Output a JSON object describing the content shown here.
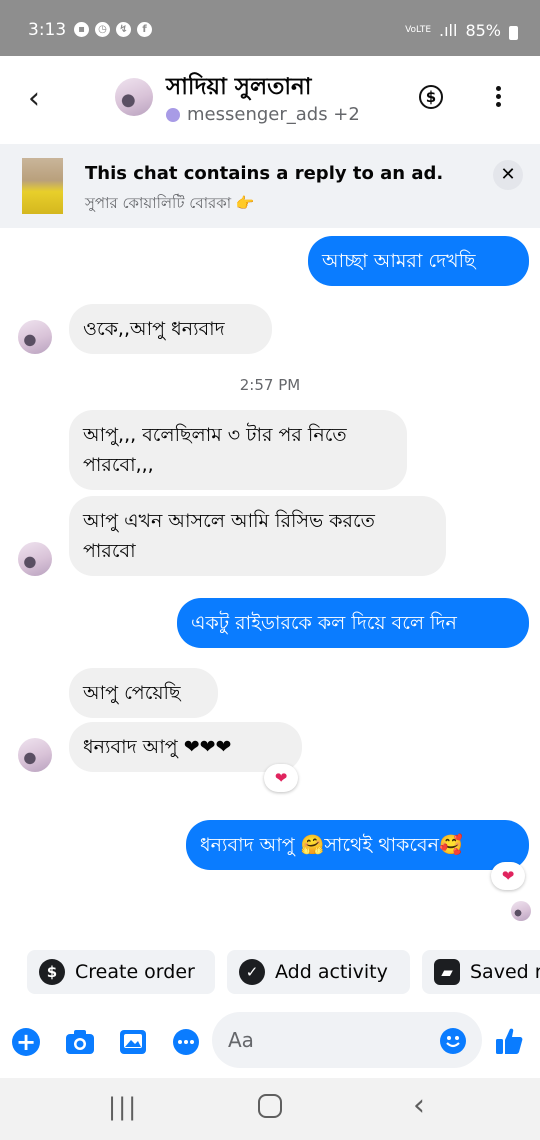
{
  "status_bar": {
    "time": "3:13",
    "network": "VoLTE",
    "battery": "85%",
    "app_icons": [
      "message-icon",
      "clock-icon",
      "messenger-icon",
      "facebook-icon"
    ]
  },
  "header": {
    "contact_name": "সাদিয়া সুলতানা",
    "subtitle": "messenger_ads +2"
  },
  "ad_banner": {
    "title": "This chat contains a reply to an ad.",
    "subtitle": "সুপার কোয়ালিটি বোরকা 👉"
  },
  "messages": [
    {
      "sender": "me",
      "text": "আচ্ছা আমরা দেখছি"
    },
    {
      "sender": "them",
      "text": "ওকে,,আপু ধন্যবাদ"
    },
    {
      "sender": "them",
      "text": "আপু,,, বলেছিলাম ৩ টার পর নিতে পারবো,,,"
    },
    {
      "sender": "them",
      "text": "আপু এখন আসলে আমি রিসিভ করতে পারবো"
    },
    {
      "sender": "me",
      "text": "একটু রাইডারকে কল দিয়ে বলে দিন"
    },
    {
      "sender": "them",
      "text": "আপু পেয়েছি"
    },
    {
      "sender": "them",
      "text": "ধন্যবাদ আপু ❤❤❤",
      "reaction": "❤"
    },
    {
      "sender": "me",
      "text": "ধন্যবাদ আপু 🤗সাথেই থাকবেন🥰",
      "reaction": "❤"
    }
  ],
  "timestamp": "2:57 PM",
  "quick_actions": [
    {
      "icon": "dollar-icon",
      "label": "Create order"
    },
    {
      "icon": "check-circle-icon",
      "label": "Add activity"
    },
    {
      "icon": "chat-bubbles-icon",
      "label": "Saved r"
    }
  ],
  "composer": {
    "placeholder": "Aa"
  },
  "colors": {
    "outgoing_bubble": "#0a7cff",
    "incoming_bubble": "#f0f0f0",
    "accent": "#0a7cff",
    "status_bar": "#8e8e8e"
  }
}
